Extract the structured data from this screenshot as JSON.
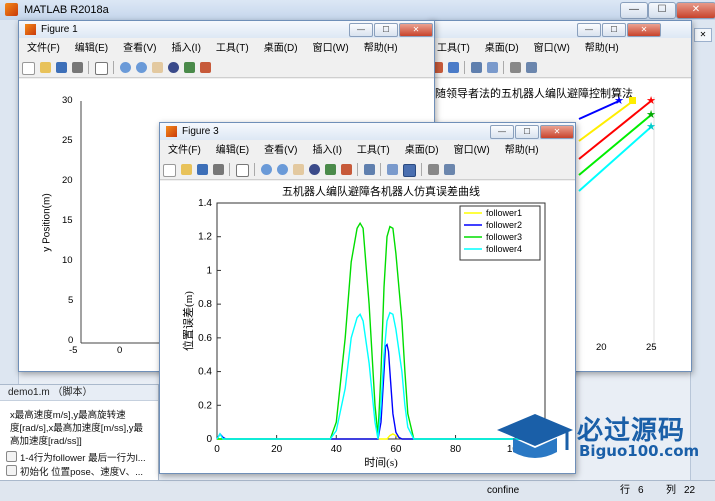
{
  "app": {
    "title": "MATLAB R2018a"
  },
  "window_controls": {
    "minimize": "—",
    "maximize": "☐",
    "close": "✕"
  },
  "script_panel": {
    "header": "demo1.m （脚本）",
    "lines": [
      "x最高速度m/s],y最高旋转速",
      "度[rad/s],x最高加速度[m/ss],y最",
      "高加速度[rad/ss]]"
    ],
    "items": [
      "1-4行为follower 最后一行为l...",
      "初始化 位置pose、速度V、..."
    ]
  },
  "status": {
    "command": "confine",
    "row_label": "行",
    "row": "6",
    "col_label": "列",
    "col": "22"
  },
  "menus": [
    "文件(F)",
    "编辑(E)",
    "查看(V)",
    "插入(I)",
    "工具(T)",
    "桌面(D)",
    "窗口(W)",
    "帮助(H)"
  ],
  "figure1": {
    "title": "Figure 1",
    "ylabel": "y Position(m)",
    "yticks": [
      "30",
      "25",
      "20",
      "15",
      "10",
      "5",
      "0"
    ],
    "xticks": [
      "-5",
      "0"
    ]
  },
  "figure2": {
    "visible_menus": [
      "工具(T)",
      "桌面(D)",
      "窗口(W)",
      "帮助(H)"
    ],
    "title": "随领导者法的五机器人编队避障控制算法",
    "xticks": [
      "20",
      "25"
    ]
  },
  "figure3": {
    "title": "Figure 3"
  },
  "chart_data": {
    "type": "line",
    "title": "五机器人编队避障各机器人仿真误差曲线",
    "xlabel": "时间(s)",
    "ylabel": "位置误差(m)",
    "xlim": [
      0,
      110
    ],
    "ylim": [
      0,
      1.4
    ],
    "xticks": [
      0,
      20,
      40,
      60,
      80,
      100
    ],
    "yticks": [
      0,
      0.2,
      0.4,
      0.6,
      0.8,
      1.0,
      1.2,
      1.4
    ],
    "legend_position": "top-right",
    "series": [
      {
        "name": "follower1",
        "color": "#ffff00",
        "x": [
          0,
          57,
          58,
          59,
          60,
          61,
          62,
          110
        ],
        "y": [
          0,
          0,
          0.02,
          0.03,
          0.02,
          0.01,
          0,
          0
        ]
      },
      {
        "name": "follower2",
        "color": "#0000ff",
        "x": [
          0,
          1,
          2,
          3,
          54,
          55,
          56,
          56.5,
          57,
          57.5,
          58,
          59,
          60,
          61,
          62,
          110
        ],
        "y": [
          0,
          0.03,
          0.01,
          0,
          0,
          0.1,
          0.4,
          0.55,
          0.56,
          0.52,
          0.4,
          0.15,
          0.04,
          0.01,
          0,
          0
        ]
      },
      {
        "name": "follower3",
        "color": "#00dd00",
        "x": [
          0,
          38,
          40,
          43,
          45,
          47,
          48,
          49,
          51,
          53,
          54,
          55,
          56,
          57,
          58,
          59,
          60,
          62,
          63,
          64,
          66,
          110
        ],
        "y": [
          0,
          0,
          0.1,
          0.6,
          1.05,
          1.25,
          1.28,
          1.25,
          0.8,
          0.2,
          0.02,
          0.4,
          0.9,
          1.2,
          1.26,
          1.25,
          1.1,
          0.7,
          0.4,
          0.15,
          0,
          0
        ]
      },
      {
        "name": "follower4",
        "color": "#00ffff",
        "x": [
          0,
          1,
          2,
          38,
          40,
          43,
          45,
          47,
          48,
          49,
          51,
          53,
          54,
          55,
          56,
          57,
          58,
          59,
          60,
          62,
          63,
          64,
          66,
          110
        ],
        "y": [
          0,
          0.03,
          0,
          0,
          0.05,
          0.3,
          0.6,
          0.72,
          0.74,
          0.7,
          0.45,
          0.1,
          0,
          0.2,
          0.5,
          0.7,
          0.75,
          0.74,
          0.65,
          0.4,
          0.2,
          0.07,
          0,
          0
        ]
      }
    ]
  },
  "watermark": {
    "cn": "必过源码",
    "en": "Biguo100.com"
  }
}
